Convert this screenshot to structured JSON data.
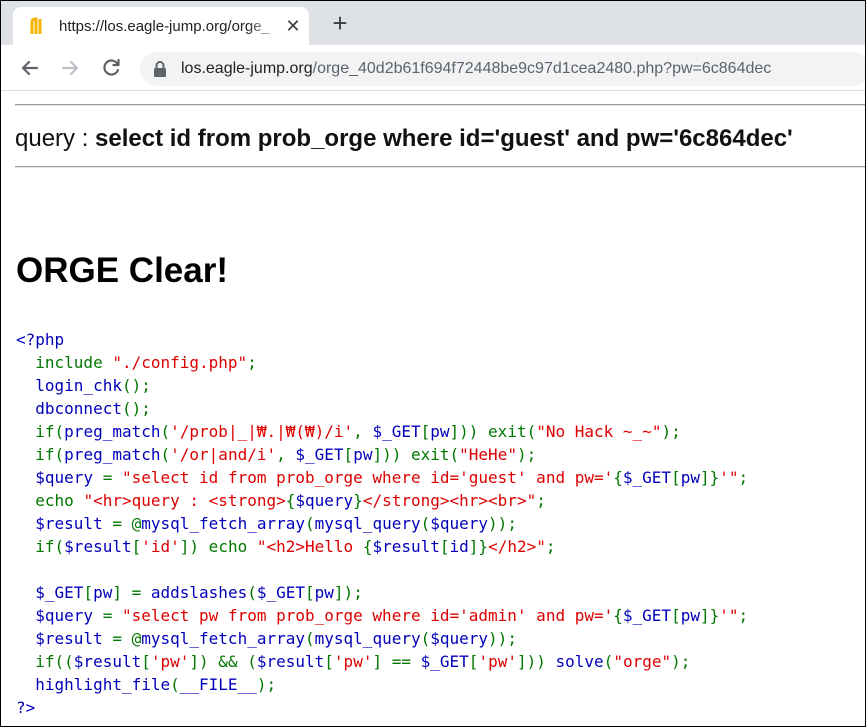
{
  "browser": {
    "tab_title": "https://los.eagle-jump.org/orge_",
    "tab_close_glyph": "✕",
    "new_tab_glyph": "+",
    "url_host": "los.eagle-jump.org",
    "url_path": "/orge_40d2b61f694f72448be9c97d1cea2480.php?pw=6c864dec",
    "favicon_color": "#f5b400"
  },
  "page": {
    "query_prefix": "query : ",
    "query_sql": "select id from prob_orge where id='guest' and pw='6c864dec'",
    "heading": "ORGE Clear!"
  },
  "colors": {
    "default": "#0000bb",
    "keyword": "#007700",
    "string": "#dd0000"
  },
  "source_code": [
    [
      {
        "t": "<?php",
        "c": "def"
      }
    ],
    [
      {
        "t": "  include ",
        "c": "kw"
      },
      {
        "t": "\"./config.php\"",
        "c": "str"
      },
      {
        "t": ";",
        "c": "kw"
      }
    ],
    [
      {
        "t": "  ",
        "c": "kw"
      },
      {
        "t": "login_chk",
        "c": "def"
      },
      {
        "t": "();",
        "c": "kw"
      }
    ],
    [
      {
        "t": "  ",
        "c": "kw"
      },
      {
        "t": "dbconnect",
        "c": "def"
      },
      {
        "t": "();",
        "c": "kw"
      }
    ],
    [
      {
        "t": "  if(",
        "c": "kw"
      },
      {
        "t": "preg_match",
        "c": "def"
      },
      {
        "t": "(",
        "c": "kw"
      },
      {
        "t": "'/prob|_|₩.|₩(₩)/i'",
        "c": "str"
      },
      {
        "t": ", ",
        "c": "kw"
      },
      {
        "t": "$_GET",
        "c": "def"
      },
      {
        "t": "[",
        "c": "kw"
      },
      {
        "t": "pw",
        "c": "def"
      },
      {
        "t": "])) exit(",
        "c": "kw"
      },
      {
        "t": "\"No Hack ~_~\"",
        "c": "str"
      },
      {
        "t": ");",
        "c": "kw"
      }
    ],
    [
      {
        "t": "  if(",
        "c": "kw"
      },
      {
        "t": "preg_match",
        "c": "def"
      },
      {
        "t": "(",
        "c": "kw"
      },
      {
        "t": "'/or|and/i'",
        "c": "str"
      },
      {
        "t": ", ",
        "c": "kw"
      },
      {
        "t": "$_GET",
        "c": "def"
      },
      {
        "t": "[",
        "c": "kw"
      },
      {
        "t": "pw",
        "c": "def"
      },
      {
        "t": "])) exit(",
        "c": "kw"
      },
      {
        "t": "\"HeHe\"",
        "c": "str"
      },
      {
        "t": ");",
        "c": "kw"
      }
    ],
    [
      {
        "t": "  $query ",
        "c": "def"
      },
      {
        "t": "= ",
        "c": "kw"
      },
      {
        "t": "\"select id from prob_orge where id='guest' and pw='",
        "c": "str"
      },
      {
        "t": "{",
        "c": "kw"
      },
      {
        "t": "$_GET",
        "c": "def"
      },
      {
        "t": "[",
        "c": "kw"
      },
      {
        "t": "pw",
        "c": "def"
      },
      {
        "t": "]}",
        "c": "kw"
      },
      {
        "t": "'\"",
        "c": "str"
      },
      {
        "t": ";",
        "c": "kw"
      }
    ],
    [
      {
        "t": "  echo ",
        "c": "kw"
      },
      {
        "t": "\"<hr>query : <strong>",
        "c": "str"
      },
      {
        "t": "{",
        "c": "kw"
      },
      {
        "t": "$query",
        "c": "def"
      },
      {
        "t": "}",
        "c": "kw"
      },
      {
        "t": "</strong><hr><br>\"",
        "c": "str"
      },
      {
        "t": ";",
        "c": "kw"
      }
    ],
    [
      {
        "t": "  $result ",
        "c": "def"
      },
      {
        "t": "= @",
        "c": "kw"
      },
      {
        "t": "mysql_fetch_array",
        "c": "def"
      },
      {
        "t": "(",
        "c": "kw"
      },
      {
        "t": "mysql_query",
        "c": "def"
      },
      {
        "t": "(",
        "c": "kw"
      },
      {
        "t": "$query",
        "c": "def"
      },
      {
        "t": "));",
        "c": "kw"
      }
    ],
    [
      {
        "t": "  if(",
        "c": "kw"
      },
      {
        "t": "$result",
        "c": "def"
      },
      {
        "t": "[",
        "c": "kw"
      },
      {
        "t": "'id'",
        "c": "str"
      },
      {
        "t": "]) echo ",
        "c": "kw"
      },
      {
        "t": "\"<h2>Hello ",
        "c": "str"
      },
      {
        "t": "{",
        "c": "kw"
      },
      {
        "t": "$result",
        "c": "def"
      },
      {
        "t": "[",
        "c": "kw"
      },
      {
        "t": "id",
        "c": "def"
      },
      {
        "t": "]}",
        "c": "kw"
      },
      {
        "t": "</h2>\"",
        "c": "str"
      },
      {
        "t": ";",
        "c": "kw"
      }
    ],
    [
      {
        "t": " ",
        "c": "kw"
      }
    ],
    [
      {
        "t": "  $_GET",
        "c": "def"
      },
      {
        "t": "[",
        "c": "kw"
      },
      {
        "t": "pw",
        "c": "def"
      },
      {
        "t": "] = ",
        "c": "kw"
      },
      {
        "t": "addslashes",
        "c": "def"
      },
      {
        "t": "(",
        "c": "kw"
      },
      {
        "t": "$_GET",
        "c": "def"
      },
      {
        "t": "[",
        "c": "kw"
      },
      {
        "t": "pw",
        "c": "def"
      },
      {
        "t": "]);",
        "c": "kw"
      }
    ],
    [
      {
        "t": "  $query ",
        "c": "def"
      },
      {
        "t": "= ",
        "c": "kw"
      },
      {
        "t": "\"select pw from prob_orge where id='admin' and pw='",
        "c": "str"
      },
      {
        "t": "{",
        "c": "kw"
      },
      {
        "t": "$_GET",
        "c": "def"
      },
      {
        "t": "[",
        "c": "kw"
      },
      {
        "t": "pw",
        "c": "def"
      },
      {
        "t": "]}",
        "c": "kw"
      },
      {
        "t": "'\"",
        "c": "str"
      },
      {
        "t": ";",
        "c": "kw"
      }
    ],
    [
      {
        "t": "  $result ",
        "c": "def"
      },
      {
        "t": "= @",
        "c": "kw"
      },
      {
        "t": "mysql_fetch_array",
        "c": "def"
      },
      {
        "t": "(",
        "c": "kw"
      },
      {
        "t": "mysql_query",
        "c": "def"
      },
      {
        "t": "(",
        "c": "kw"
      },
      {
        "t": "$query",
        "c": "def"
      },
      {
        "t": "));",
        "c": "kw"
      }
    ],
    [
      {
        "t": "  if((",
        "c": "kw"
      },
      {
        "t": "$result",
        "c": "def"
      },
      {
        "t": "[",
        "c": "kw"
      },
      {
        "t": "'pw'",
        "c": "str"
      },
      {
        "t": "]) && (",
        "c": "kw"
      },
      {
        "t": "$result",
        "c": "def"
      },
      {
        "t": "[",
        "c": "kw"
      },
      {
        "t": "'pw'",
        "c": "str"
      },
      {
        "t": "] == ",
        "c": "kw"
      },
      {
        "t": "$_GET",
        "c": "def"
      },
      {
        "t": "[",
        "c": "kw"
      },
      {
        "t": "'pw'",
        "c": "str"
      },
      {
        "t": "])) ",
        "c": "kw"
      },
      {
        "t": "solve",
        "c": "def"
      },
      {
        "t": "(",
        "c": "kw"
      },
      {
        "t": "\"orge\"",
        "c": "str"
      },
      {
        "t": ");",
        "c": "kw"
      }
    ],
    [
      {
        "t": "  ",
        "c": "kw"
      },
      {
        "t": "highlight_file",
        "c": "def"
      },
      {
        "t": "(",
        "c": "kw"
      },
      {
        "t": "__FILE__",
        "c": "def"
      },
      {
        "t": ");",
        "c": "kw"
      }
    ],
    [
      {
        "t": "?>",
        "c": "def"
      }
    ]
  ]
}
